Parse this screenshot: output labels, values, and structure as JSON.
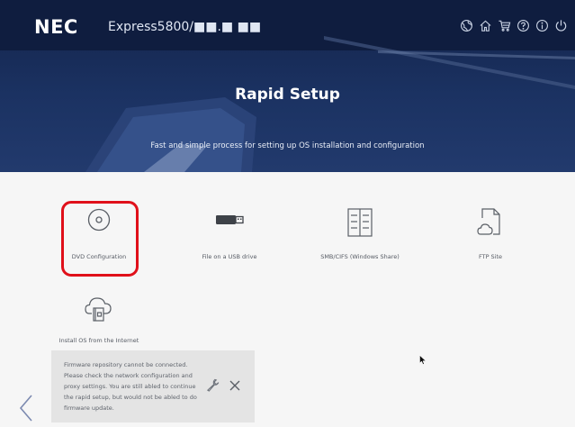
{
  "header": {
    "logo": "NEC",
    "product": "Express5800/■■.■ ■■",
    "title": "Rapid Setup",
    "subtitle": "Fast and simple process for setting up OS installation and configuration",
    "icons": [
      "globe-icon",
      "home-icon",
      "cart-icon",
      "help-icon",
      "info-icon",
      "power-icon"
    ]
  },
  "options": [
    {
      "label": "DVD Configuration",
      "icon": "disc-icon",
      "selected": true
    },
    {
      "label": "File on a USB drive",
      "icon": "usb-drive-icon"
    },
    {
      "label": "SMB/CIFS (Windows Share)",
      "icon": "server-share-icon"
    },
    {
      "label": "FTP Site",
      "icon": "cloud-file-icon"
    },
    {
      "label": "Install OS from the Internet",
      "icon": "cloud-download-icon"
    }
  ],
  "notice": {
    "text": "Firmware repository cannot be connected. Please check the network configuration and proxy settings. You are still abled to continue the rapid setup, but would not be abled to do firmware update."
  },
  "colors": {
    "header_dark": "#0f1d3f",
    "header_blue": "#1b3262",
    "highlight": "#e0101a",
    "icon_gray": "#5a5f66"
  }
}
